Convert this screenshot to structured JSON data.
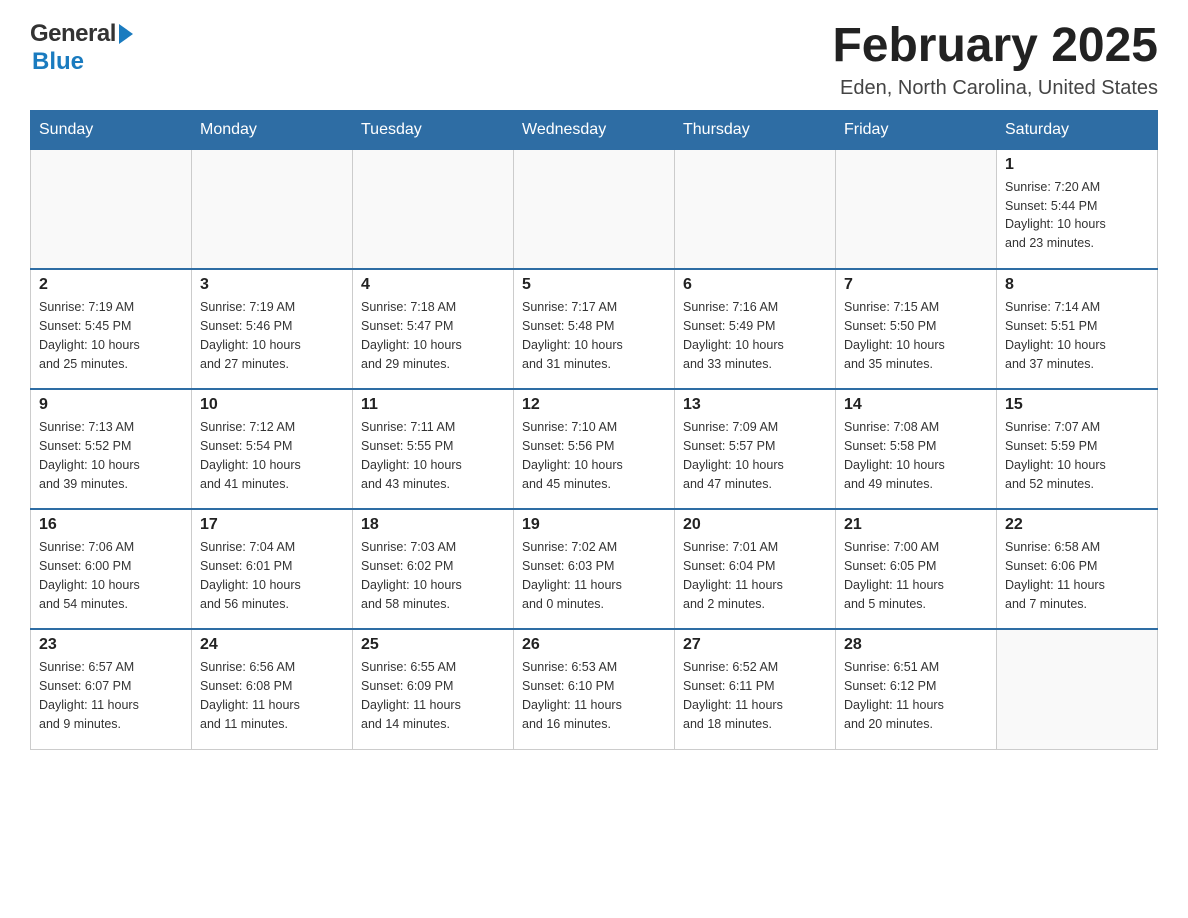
{
  "logo": {
    "text_general": "General",
    "triangle": "▶",
    "text_blue": "Blue"
  },
  "header": {
    "month_year": "February 2025",
    "location": "Eden, North Carolina, United States"
  },
  "weekdays": [
    "Sunday",
    "Monday",
    "Tuesday",
    "Wednesday",
    "Thursday",
    "Friday",
    "Saturday"
  ],
  "weeks": [
    [
      {
        "day": "",
        "info": ""
      },
      {
        "day": "",
        "info": ""
      },
      {
        "day": "",
        "info": ""
      },
      {
        "day": "",
        "info": ""
      },
      {
        "day": "",
        "info": ""
      },
      {
        "day": "",
        "info": ""
      },
      {
        "day": "1",
        "info": "Sunrise: 7:20 AM\nSunset: 5:44 PM\nDaylight: 10 hours\nand 23 minutes."
      }
    ],
    [
      {
        "day": "2",
        "info": "Sunrise: 7:19 AM\nSunset: 5:45 PM\nDaylight: 10 hours\nand 25 minutes."
      },
      {
        "day": "3",
        "info": "Sunrise: 7:19 AM\nSunset: 5:46 PM\nDaylight: 10 hours\nand 27 minutes."
      },
      {
        "day": "4",
        "info": "Sunrise: 7:18 AM\nSunset: 5:47 PM\nDaylight: 10 hours\nand 29 minutes."
      },
      {
        "day": "5",
        "info": "Sunrise: 7:17 AM\nSunset: 5:48 PM\nDaylight: 10 hours\nand 31 minutes."
      },
      {
        "day": "6",
        "info": "Sunrise: 7:16 AM\nSunset: 5:49 PM\nDaylight: 10 hours\nand 33 minutes."
      },
      {
        "day": "7",
        "info": "Sunrise: 7:15 AM\nSunset: 5:50 PM\nDaylight: 10 hours\nand 35 minutes."
      },
      {
        "day": "8",
        "info": "Sunrise: 7:14 AM\nSunset: 5:51 PM\nDaylight: 10 hours\nand 37 minutes."
      }
    ],
    [
      {
        "day": "9",
        "info": "Sunrise: 7:13 AM\nSunset: 5:52 PM\nDaylight: 10 hours\nand 39 minutes."
      },
      {
        "day": "10",
        "info": "Sunrise: 7:12 AM\nSunset: 5:54 PM\nDaylight: 10 hours\nand 41 minutes."
      },
      {
        "day": "11",
        "info": "Sunrise: 7:11 AM\nSunset: 5:55 PM\nDaylight: 10 hours\nand 43 minutes."
      },
      {
        "day": "12",
        "info": "Sunrise: 7:10 AM\nSunset: 5:56 PM\nDaylight: 10 hours\nand 45 minutes."
      },
      {
        "day": "13",
        "info": "Sunrise: 7:09 AM\nSunset: 5:57 PM\nDaylight: 10 hours\nand 47 minutes."
      },
      {
        "day": "14",
        "info": "Sunrise: 7:08 AM\nSunset: 5:58 PM\nDaylight: 10 hours\nand 49 minutes."
      },
      {
        "day": "15",
        "info": "Sunrise: 7:07 AM\nSunset: 5:59 PM\nDaylight: 10 hours\nand 52 minutes."
      }
    ],
    [
      {
        "day": "16",
        "info": "Sunrise: 7:06 AM\nSunset: 6:00 PM\nDaylight: 10 hours\nand 54 minutes."
      },
      {
        "day": "17",
        "info": "Sunrise: 7:04 AM\nSunset: 6:01 PM\nDaylight: 10 hours\nand 56 minutes."
      },
      {
        "day": "18",
        "info": "Sunrise: 7:03 AM\nSunset: 6:02 PM\nDaylight: 10 hours\nand 58 minutes."
      },
      {
        "day": "19",
        "info": "Sunrise: 7:02 AM\nSunset: 6:03 PM\nDaylight: 11 hours\nand 0 minutes."
      },
      {
        "day": "20",
        "info": "Sunrise: 7:01 AM\nSunset: 6:04 PM\nDaylight: 11 hours\nand 2 minutes."
      },
      {
        "day": "21",
        "info": "Sunrise: 7:00 AM\nSunset: 6:05 PM\nDaylight: 11 hours\nand 5 minutes."
      },
      {
        "day": "22",
        "info": "Sunrise: 6:58 AM\nSunset: 6:06 PM\nDaylight: 11 hours\nand 7 minutes."
      }
    ],
    [
      {
        "day": "23",
        "info": "Sunrise: 6:57 AM\nSunset: 6:07 PM\nDaylight: 11 hours\nand 9 minutes."
      },
      {
        "day": "24",
        "info": "Sunrise: 6:56 AM\nSunset: 6:08 PM\nDaylight: 11 hours\nand 11 minutes."
      },
      {
        "day": "25",
        "info": "Sunrise: 6:55 AM\nSunset: 6:09 PM\nDaylight: 11 hours\nand 14 minutes."
      },
      {
        "day": "26",
        "info": "Sunrise: 6:53 AM\nSunset: 6:10 PM\nDaylight: 11 hours\nand 16 minutes."
      },
      {
        "day": "27",
        "info": "Sunrise: 6:52 AM\nSunset: 6:11 PM\nDaylight: 11 hours\nand 18 minutes."
      },
      {
        "day": "28",
        "info": "Sunrise: 6:51 AM\nSunset: 6:12 PM\nDaylight: 11 hours\nand 20 minutes."
      },
      {
        "day": "",
        "info": ""
      }
    ]
  ]
}
